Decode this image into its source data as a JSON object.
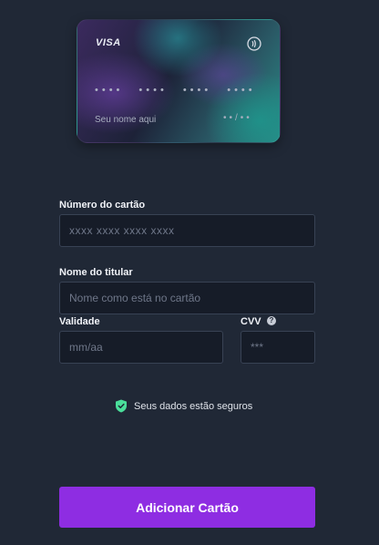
{
  "card_preview": {
    "brand": "VISA",
    "number_groups": [
      "••••",
      "••••",
      "••••",
      "••••"
    ],
    "holder_placeholder": "Seu nome aqui",
    "expiry_placeholder": "••/••",
    "contactless_icon": "contactless-icon"
  },
  "form": {
    "card_number": {
      "label": "Número do cartão",
      "placeholder": "xxxx xxxx xxxx xxxx",
      "value": ""
    },
    "holder_name": {
      "label": "Nome do titular",
      "placeholder": "Nome como está no cartão",
      "value": ""
    },
    "expiry": {
      "label": "Validade",
      "placeholder": "mm/aa",
      "value": ""
    },
    "cvv": {
      "label": "CVV",
      "placeholder": "***",
      "value": "",
      "help_icon": "help-circle-icon",
      "help_glyph": "?"
    }
  },
  "security_note": {
    "text": "Seus dados estão seguros",
    "icon": "shield-check-icon",
    "color": "#4ade9a"
  },
  "submit_button": {
    "label": "Adicionar Cartão",
    "color": "#8e2de2"
  }
}
